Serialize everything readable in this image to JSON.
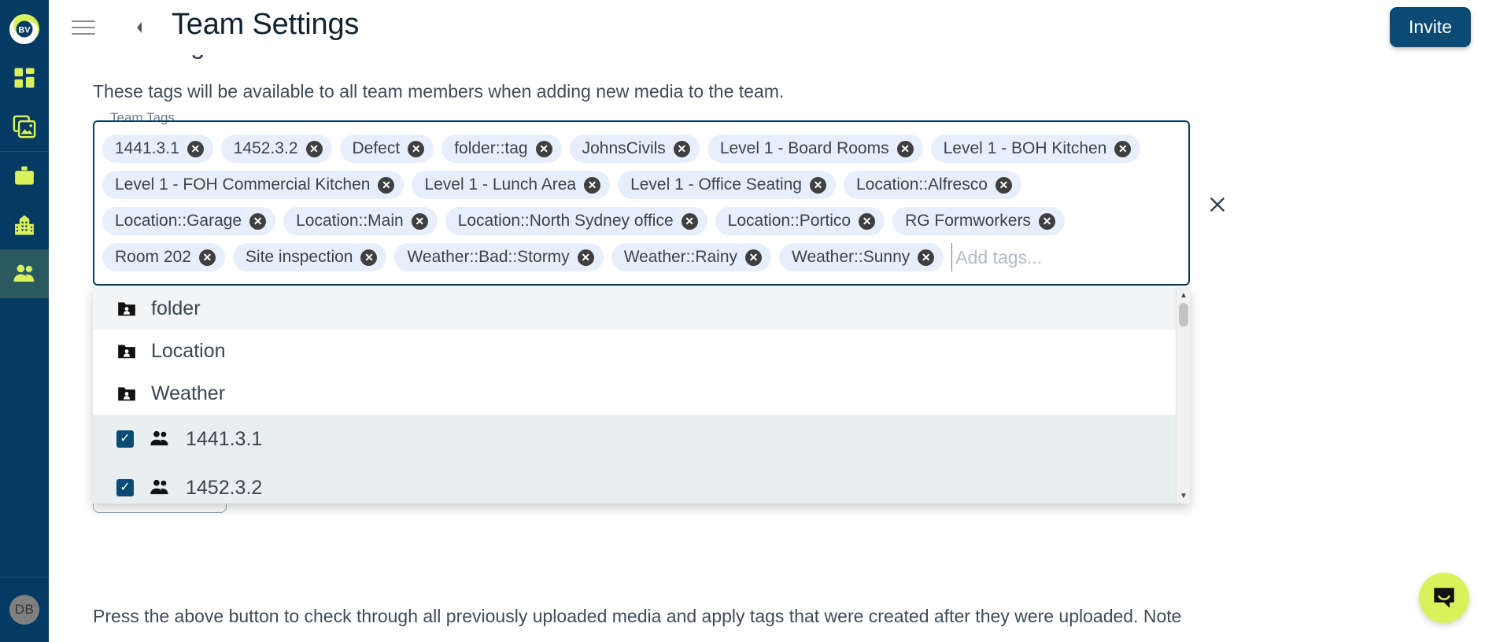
{
  "app": {
    "logo_text": "BV",
    "accent": "#d9f25c",
    "sidebar_bg": "#053a63",
    "active_bg": "#2a5a5f",
    "primary": "#0a4a73"
  },
  "sidebar": {
    "items": [
      {
        "name": "dashboard",
        "icon": "grid-icon",
        "active": false
      },
      {
        "name": "media",
        "icon": "photos-icon",
        "active": false
      },
      {
        "name": "projects",
        "icon": "briefcase-icon",
        "active": false
      },
      {
        "name": "company",
        "icon": "building-icon",
        "active": false
      },
      {
        "name": "team",
        "icon": "people-icon",
        "active": true
      }
    ],
    "avatar_initials": "DB"
  },
  "header": {
    "menu_icon": "hamburger-icon",
    "back_icon": "chevron-left-icon",
    "title": "Team Settings",
    "invite_label": "Invite"
  },
  "main": {
    "section_title": "Team Tags",
    "section_desc": "These tags will be available to all team members when adding new media to the team.",
    "field_legend": "Team Tags",
    "input_placeholder": "Add tags...",
    "input_value": "",
    "clear_icon": "close-icon",
    "bottom_note": "Press the above button to check through all previously uploaded media and apply tags that were created after they were uploaded. Note"
  },
  "tags": [
    "1441.3.1",
    "1452.3.2",
    "Defect",
    "folder::tag",
    "JohnsCivils",
    "Level 1 - Board Rooms",
    "Level 1 - BOH Kitchen",
    "Level 1 - FOH Commercial Kitchen",
    "Level 1 - Lunch Area",
    "Level 1 - Office Seating",
    "Location::Alfresco",
    "Location::Garage",
    "Location::Main",
    "Location::North Sydney office",
    "Location::Portico",
    "RG Formworkers",
    "Room 202",
    "Site inspection",
    "Weather::Bad::Stormy",
    "Weather::Rainy",
    "Weather::Sunny"
  ],
  "dropdown": {
    "options": [
      {
        "label": "folder",
        "type": "group",
        "icon": "folder-person-icon",
        "highlighted": true,
        "checked": false
      },
      {
        "label": "Location",
        "type": "group",
        "icon": "folder-person-icon",
        "highlighted": false,
        "checked": false
      },
      {
        "label": "Weather",
        "type": "group",
        "icon": "folder-person-icon",
        "highlighted": false,
        "checked": false
      },
      {
        "label": "1441.3.1",
        "type": "member",
        "icon": "people-icon",
        "highlighted": false,
        "checked": true
      },
      {
        "label": "1452.3.2",
        "type": "member",
        "icon": "people-icon",
        "highlighted": false,
        "checked": true
      }
    ],
    "scroll_up_icon": "caret-up-icon",
    "scroll_down_icon": "caret-down-icon"
  },
  "chat": {
    "icon": "chat-bubble-icon"
  }
}
